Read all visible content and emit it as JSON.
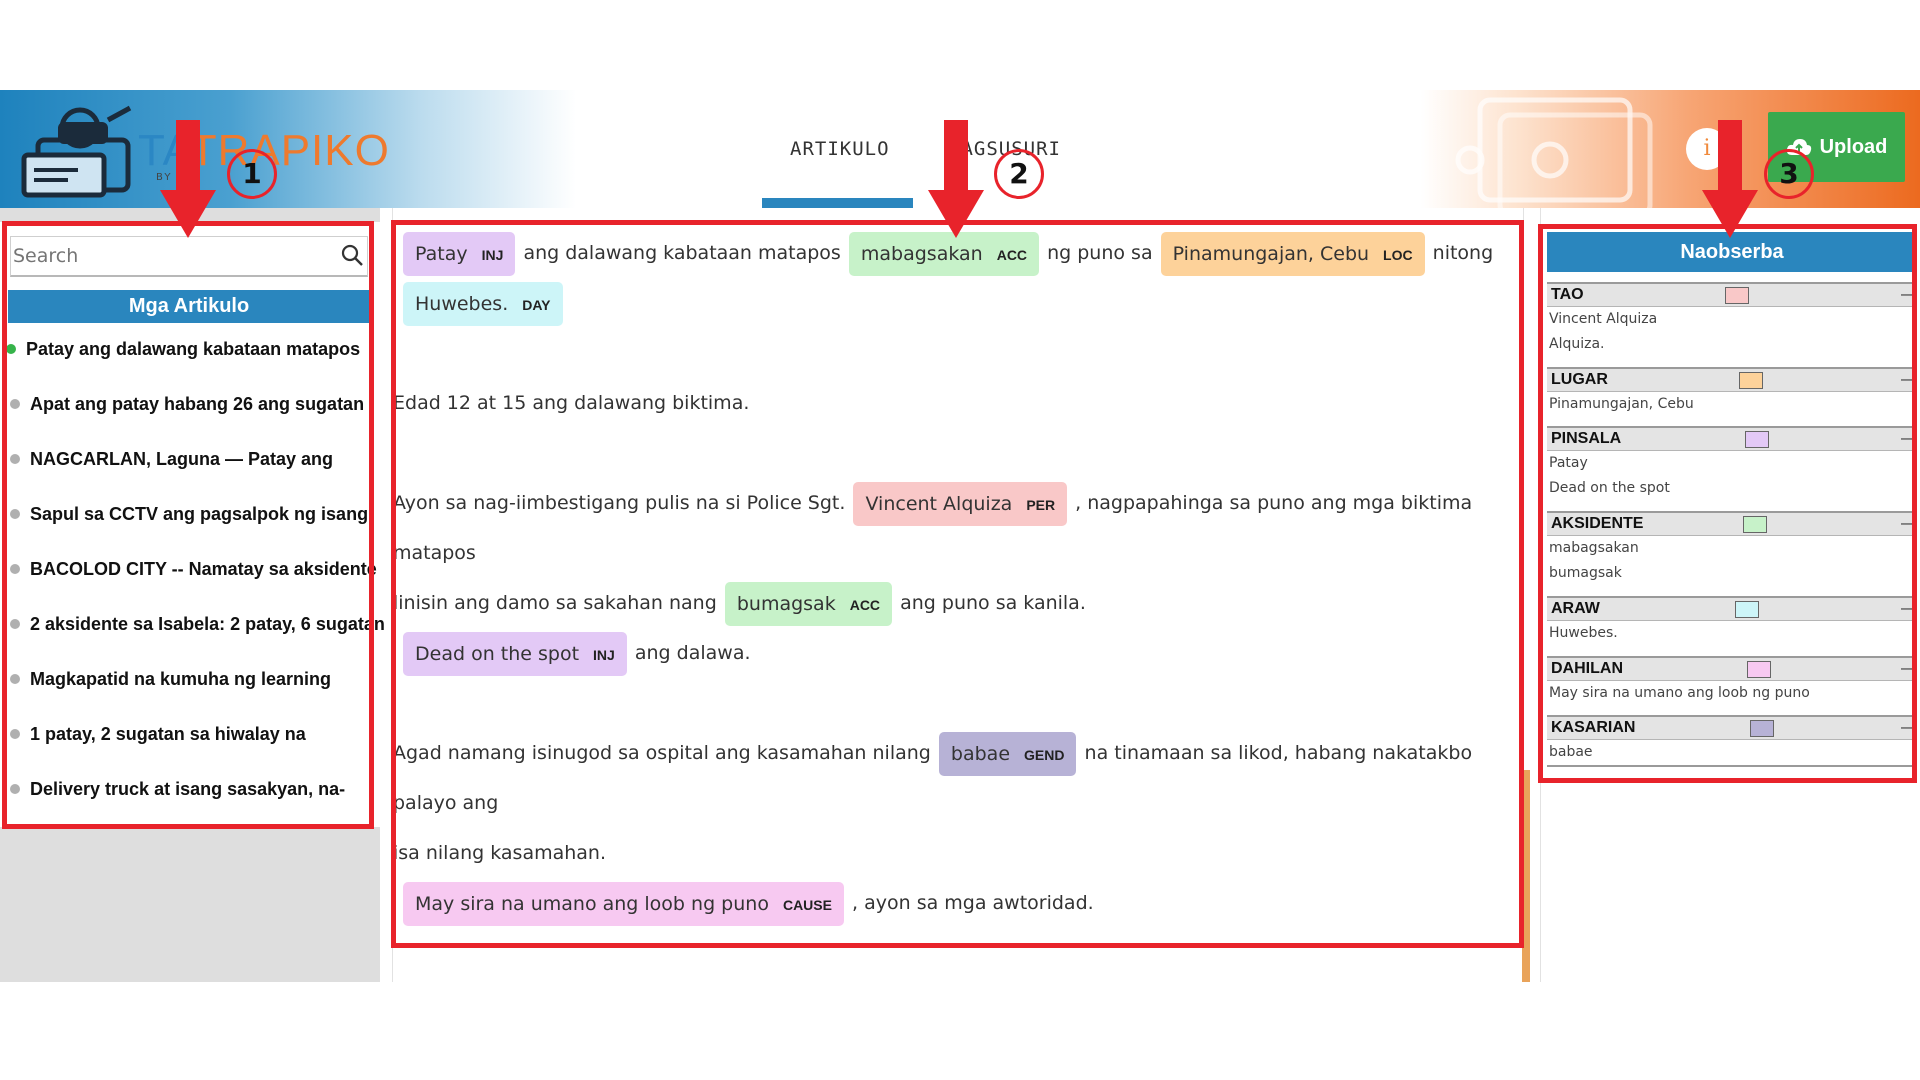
{
  "header": {
    "brand_part1": "TA",
    "brand_part2": "TRAPIKO",
    "brand_sub": "BY",
    "tabs": [
      "ARTIKULO",
      "PAGSUSURI"
    ],
    "info_label": "i",
    "upload_label": "Upload"
  },
  "sidebar": {
    "search_placeholder": "Search",
    "title": "Mga Artikulo",
    "articles": [
      "Patay ang dalawang kabataan matapos",
      "Apat ang patay habang 26 ang sugatan",
      "NAGCARLAN, Laguna — Patay ang",
      "Sapul sa CCTV ang pagsalpok ng isang",
      "BACOLOD CITY -- Namatay sa aksidente",
      "2 aksidente sa Isabela: 2 patay, 6 sugatan",
      "Magkapatid na kumuha ng learning",
      "1 patay, 2 sugatan sa hiwalay na",
      "Delivery truck at isang sasakyan, na-"
    ],
    "active_index": 0
  },
  "article": {
    "p1": {
      "t1": "Patay",
      "l1": "INJ",
      "s1": "ang dalawang kabataan matapos",
      "t2": "mabagsakan",
      "l2": "ACC",
      "s2": "ng puno sa",
      "t3": "Pinamungajan, Cebu",
      "l3": "LOC",
      "s3": "nitong",
      "t4": "Huwebes.",
      "l4": "DAY"
    },
    "p2": "Edad 12 at 15 ang dalawang biktima.",
    "p3": {
      "s1": "Ayon sa nag-iimbestigang pulis na si Police Sgt.",
      "t1": "Vincent Alquiza",
      "l1": "PER",
      "s2": ", nagpapahinga sa puno ang mga biktima matapos",
      "s3": "linisin ang damo sa sakahan nang",
      "t2": "bumagsak",
      "l2": "ACC",
      "s4": "ang puno sa kanila."
    },
    "p4": {
      "t1": "Dead on the spot",
      "l1": "INJ",
      "s1": "ang dalawa."
    },
    "p5": {
      "s1": "Agad namang isinugod sa ospital ang kasamahan nilang",
      "t1": "babae",
      "l1": "GEND",
      "s2": "na tinamaan sa likod, habang nakatakbo palayo ang",
      "s3": "isa nilang kasamahan."
    },
    "p6": {
      "t1": "May sira na umano ang loob ng puno",
      "l1": "CAUSE",
      "s1": ", ayon sa mga awtoridad."
    }
  },
  "observations": {
    "title": "Naobserba",
    "categories": [
      {
        "name": "TAO",
        "color": "#f9c8c8",
        "items": [
          "Vincent Alquiza",
          "Alquiza."
        ]
      },
      {
        "name": "LUGAR",
        "color": "#fdd29a",
        "items": [
          "Pinamungajan, Cebu"
        ]
      },
      {
        "name": "PINSALA",
        "color": "#e3c9f6",
        "items": [
          "Patay",
          "Dead on the spot"
        ]
      },
      {
        "name": "AKSIDENTE",
        "color": "#c7f2c9",
        "items": [
          "mabagsakan",
          "bumagsak"
        ]
      },
      {
        "name": "ARAW",
        "color": "#cdf5f8",
        "items": [
          "Huwebes."
        ]
      },
      {
        "name": "DAHILAN",
        "color": "#f7c9f1",
        "items": [
          "May sira na umano ang loob ng puno"
        ]
      },
      {
        "name": "KASARIAN",
        "color": "#b7b2d6",
        "items": [
          "babae"
        ]
      }
    ],
    "collapse_symbol": "—"
  },
  "annotations": {
    "n1": "1",
    "n2": "2",
    "n3": "3"
  },
  "colors": {
    "accent": "#2a86be",
    "upload": "#3aa94e",
    "annotation": "#e8232b"
  }
}
